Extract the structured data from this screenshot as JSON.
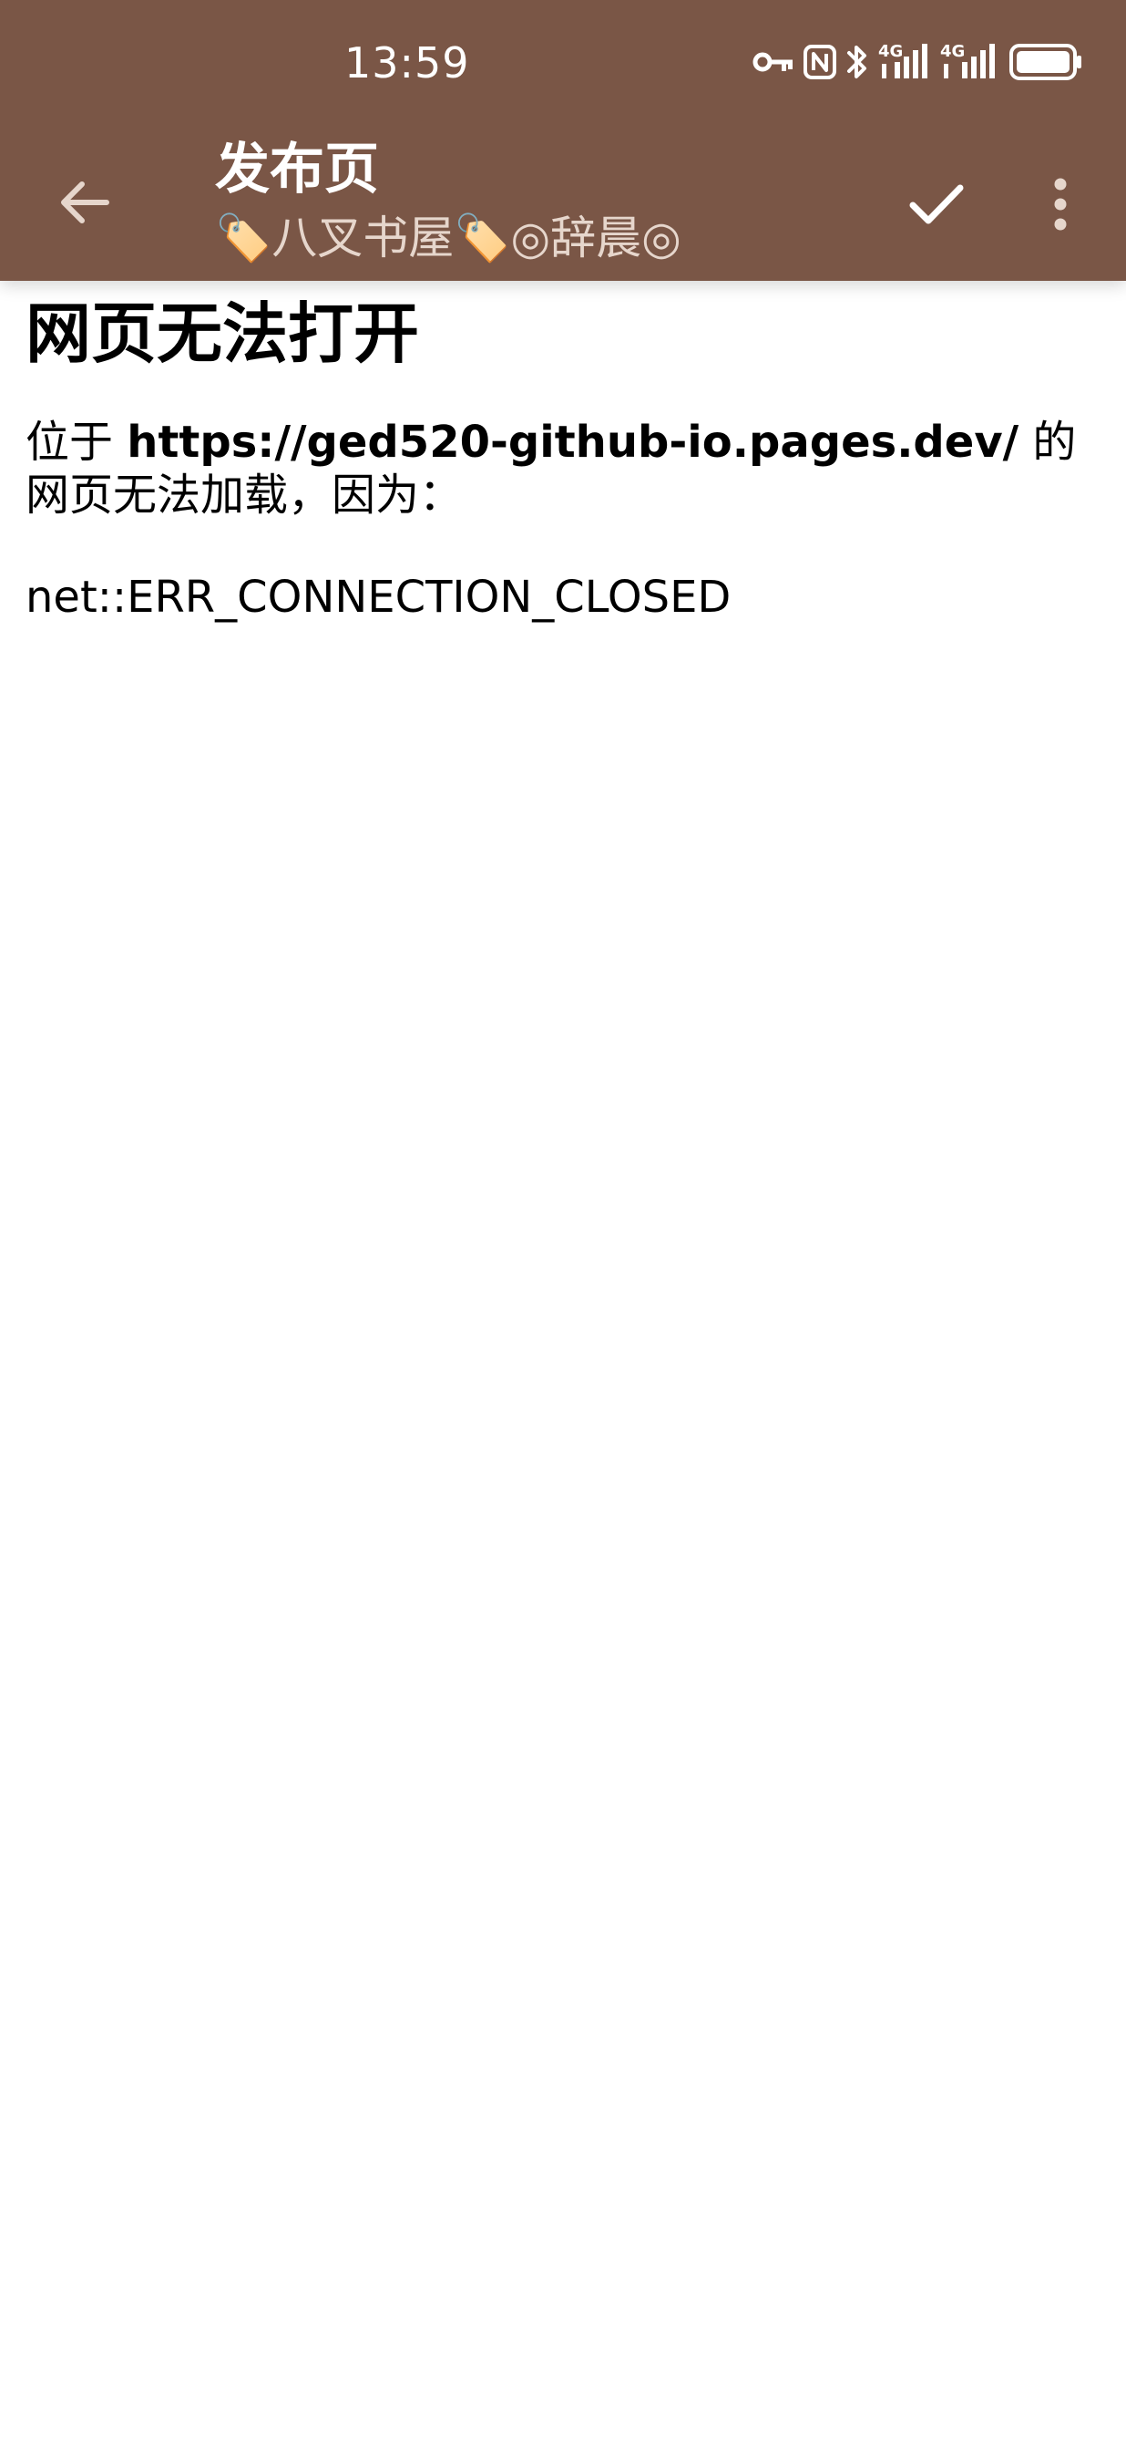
{
  "status_bar": {
    "time": "13:59",
    "icons": [
      "vpn-key-icon",
      "nfc-icon",
      "bluetooth-icon",
      "signal-4g-icon",
      "signal-4g-icon",
      "battery-icon"
    ],
    "network_labels": [
      "4G",
      "4G"
    ]
  },
  "toolbar": {
    "back_icon": "arrow-left-icon",
    "title": "发布页",
    "subtitle": "🏷️八叉书屋🏷️◎辞晨◎",
    "confirm_icon": "check-icon",
    "more_icon": "more-vertical-icon",
    "background_color": "#7a5646"
  },
  "error_page": {
    "heading": "网页无法打开",
    "message_prefix": "位于 ",
    "url": "https://ged520-github-io.pages.dev/",
    "message_suffix": " 的网页无法加载，因为：",
    "error_code": "net::ERR_CONNECTION_CLOSED"
  }
}
